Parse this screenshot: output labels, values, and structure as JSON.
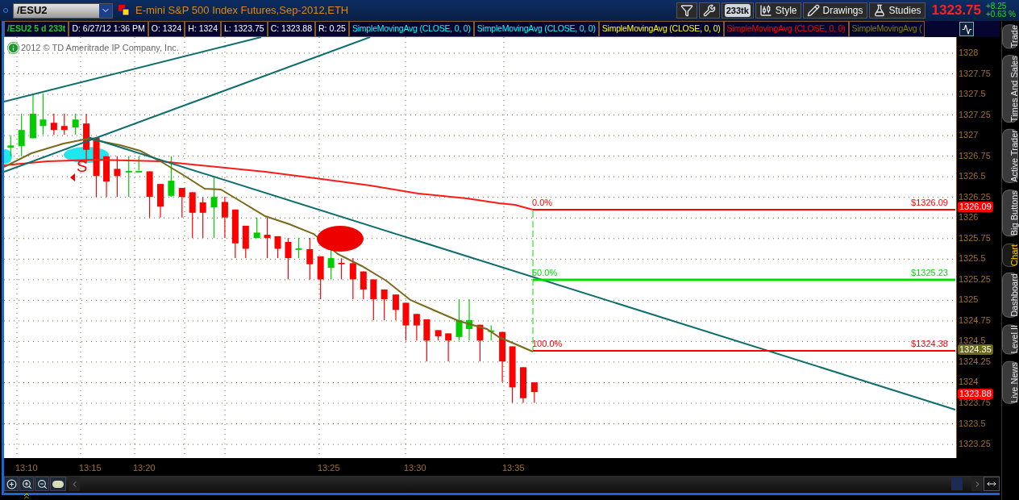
{
  "toolbar": {
    "symbol": "/ESU2",
    "title": "E-mini S&P 500 Index Futures,Sep-2012,ETH",
    "buttons": [
      {
        "kind": "funnel"
      },
      {
        "kind": "wrench"
      },
      {
        "kind": "badge",
        "label": "233tk"
      },
      {
        "kind": "style",
        "label": "Style"
      },
      {
        "kind": "drawings",
        "label": "Drawings"
      },
      {
        "kind": "studies",
        "label": "Studies"
      }
    ],
    "last_price": "1323.75",
    "change": "+8.25",
    "change_pct": "+0.63 %"
  },
  "info_bar": {
    "symbol": "/ESU2 5 d 233t",
    "fields": [
      "D: 6/27/12 1:36 PM",
      "O: 1324",
      "H: 1324",
      "L: 1323.75",
      "C: 1323.88",
      "R: 0.25"
    ],
    "studies": [
      {
        "label": "SimpleMovingAvg (CLOSE, 0, 0)",
        "color": "#00ffff"
      },
      {
        "label": "SimpleMovingAvg (CLOSE, 0, 0)",
        "color": "#00ffff"
      },
      {
        "label": "SimpleMovingAvg (CLOSE, 0, 0)",
        "color": "#ffff00"
      },
      {
        "label": "SimpleMovingAvg (CLOSE, 0, 0)",
        "color": "#ff0000"
      },
      {
        "label": "SimpleMovingAvg (",
        "color": "#808000"
      }
    ]
  },
  "chart": {
    "copyright": "2012 © TD Ameritrade IP Company, Inc.",
    "signal": "S",
    "fib_levels": [
      {
        "percent": "0.0%",
        "price": "$1326.09",
        "color": "#ff0000"
      },
      {
        "percent": "50.0%",
        "price": "$1325.23",
        "color": "#00dd00"
      },
      {
        "percent": "100.0%",
        "price": "$1324.38",
        "color": "#ff0000"
      }
    ],
    "y_labels": [
      "1328",
      "1327.75",
      "1327.5",
      "1327.25",
      "1327",
      "1326.75",
      "1326.5",
      "1326.25",
      "1326",
      "1325.75",
      "1325.5",
      "1325.25",
      "1325",
      "1324.75",
      "1324.5",
      "1324.25",
      "1324",
      "1323.75",
      "1323.5",
      "1323.25"
    ],
    "price_tags": [
      {
        "text": "1326.09",
        "color": "#ff0000"
      },
      {
        "text": "1324.35",
        "color": "#6b6b1a"
      },
      {
        "text": "1323.88",
        "color": "#ff0000"
      }
    ],
    "x_labels": [
      "13:10",
      "13:15",
      "13:20",
      "13:25",
      "13:30",
      "13:35"
    ]
  },
  "side_tabs": [
    {
      "label": "Trade",
      "selected": false
    },
    {
      "label": "Times And Sales",
      "selected": false
    },
    {
      "label": "Active Trader",
      "selected": false
    },
    {
      "label": "Big Buttons",
      "selected": false
    },
    {
      "label": "Chart",
      "selected": true
    },
    {
      "label": "Dashboard",
      "selected": false
    },
    {
      "label": "Level II",
      "selected": false
    },
    {
      "label": "Live News",
      "selected": false
    }
  ]
}
